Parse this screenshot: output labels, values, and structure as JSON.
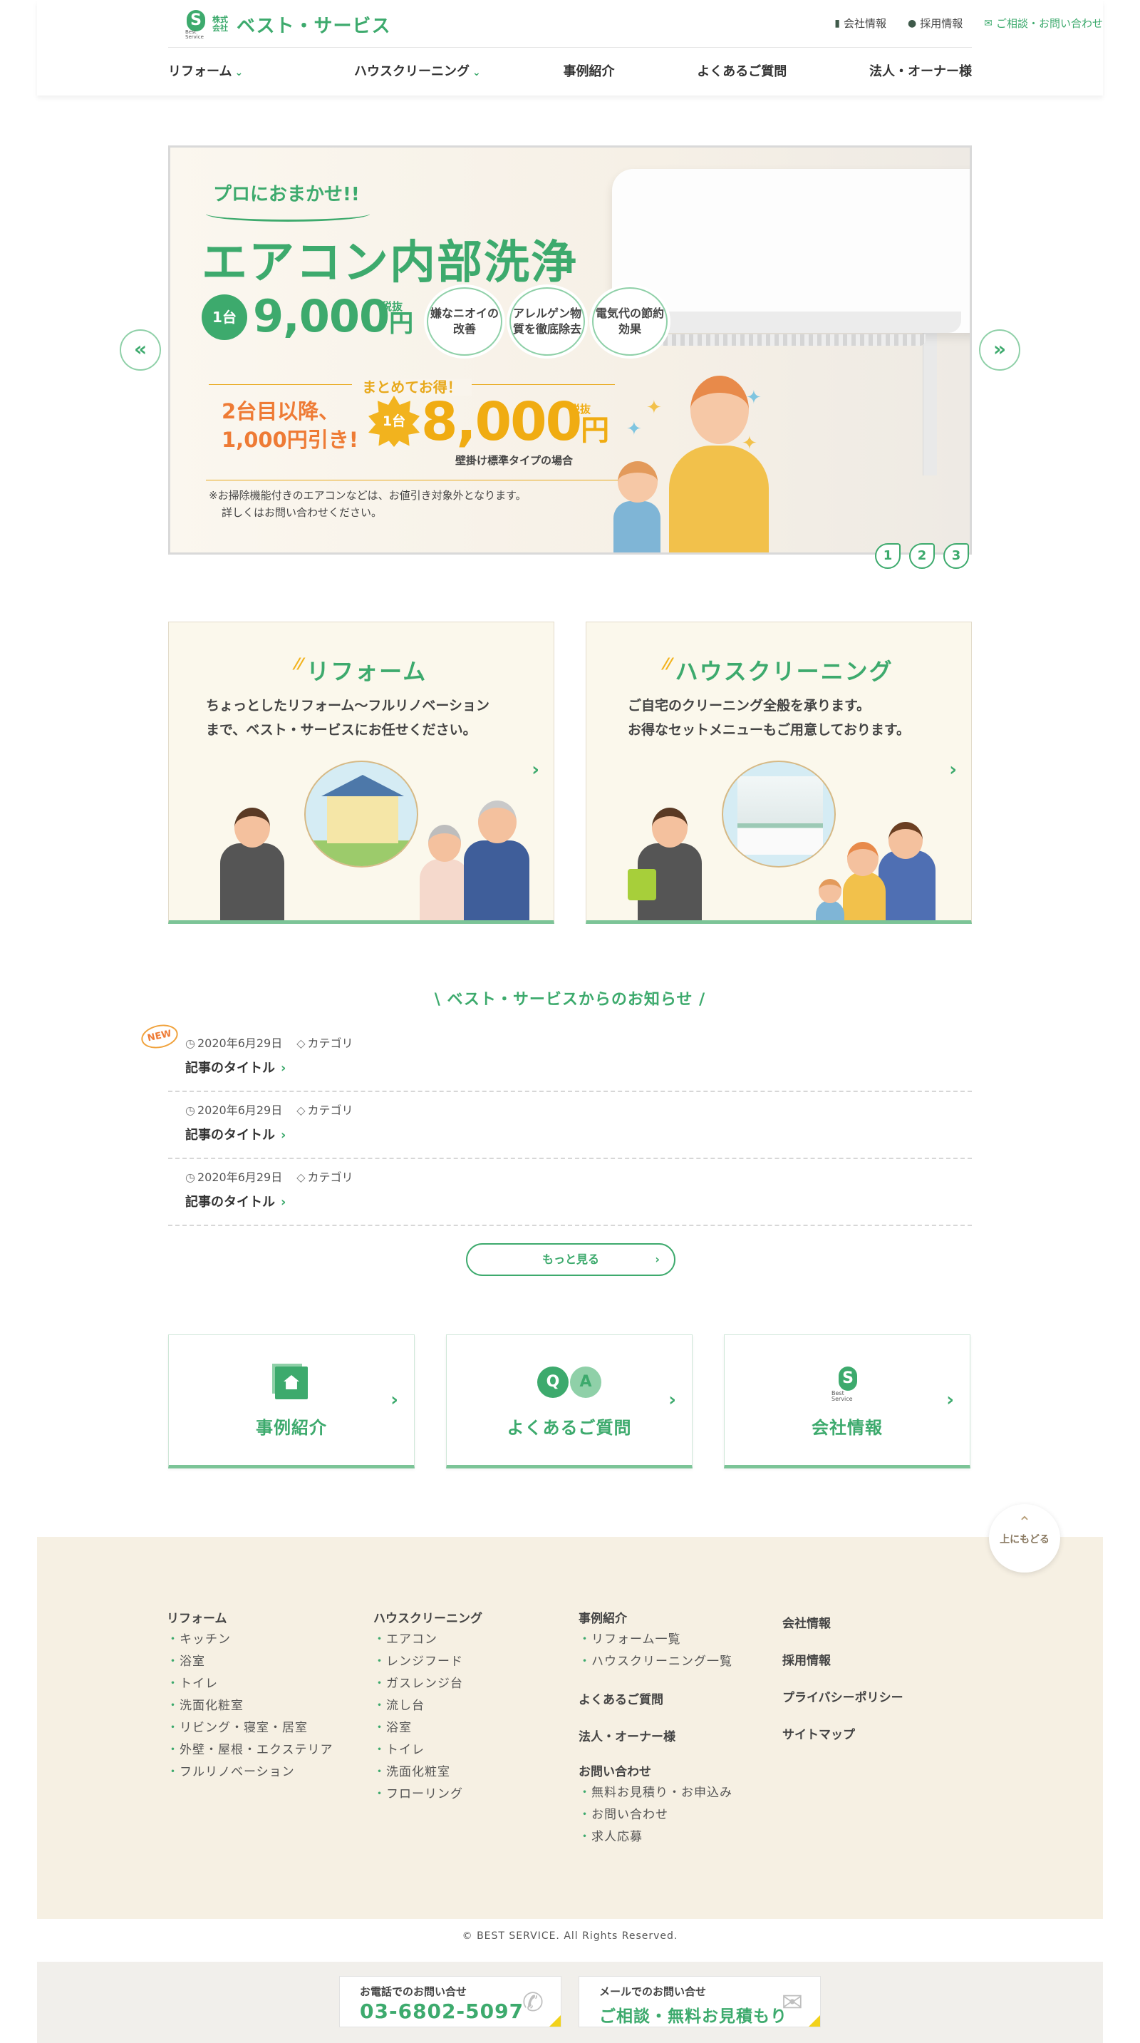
{
  "header": {
    "logo_corp": "株式会社",
    "logo_name": "ベスト・サービス",
    "logo_sub": "Best Service",
    "top_links": [
      "会社情報",
      "採用情報",
      "ご相談・お問い合わせ"
    ],
    "nav": [
      "リフォーム",
      "ハウスクリーニング",
      "事例紹介",
      "よくあるご質問",
      "法人・オーナー様"
    ]
  },
  "slider": {
    "catch": "プロにおまかせ!!",
    "headline": "エアコン内部洗浄",
    "unit1": "1台",
    "price1": "9,000",
    "yen": "円",
    "tax": "税抜",
    "features": [
      "嫌なニオイの改善",
      "アレルゲン物質を徹底除去",
      "電気代の節約効果"
    ],
    "matome": "まとめてお得！",
    "discount": [
      "2台目以降、",
      "1,000円引き!"
    ],
    "unit2": "1台",
    "price2": "8,000",
    "price_note": "壁掛け標準タイプの場合",
    "note": [
      "※お掃除機能付きのエアコンなどは、お値引き対象外となります。",
      "詳しくはお問い合わせください。"
    ],
    "dots": [
      "1",
      "2",
      "3"
    ],
    "active_dot": 1
  },
  "services": [
    {
      "title": "リフォーム",
      "desc": [
        "ちょっとしたリフォーム〜フルリノベーション",
        "まで、ベスト・サービスにお任せください。"
      ]
    },
    {
      "title": "ハウスクリーニング",
      "desc": [
        "ご自宅のクリーニング全般を承ります。",
        "お得なセットメニューもご用意しております。"
      ]
    }
  ],
  "news": {
    "title": "ベスト・サービスからのお知らせ",
    "new_label": "NEW",
    "items": [
      {
        "date": "2020年6月29日",
        "category": "カテゴリ",
        "title": "記事のタイトル"
      },
      {
        "date": "2020年6月29日",
        "category": "カテゴリ",
        "title": "記事のタイトル"
      },
      {
        "date": "2020年6月29日",
        "category": "カテゴリ",
        "title": "記事のタイトル"
      }
    ],
    "more": "もっと見る"
  },
  "link_boxes": [
    {
      "label": "事例紹介",
      "icon": "case-icon"
    },
    {
      "label": "よくあるご質問",
      "icon": "qa-icon"
    },
    {
      "label": "会社情報",
      "icon": "company-logo-icon"
    }
  ],
  "to_top": "上にもどる",
  "footer": {
    "reform": {
      "heading": "リフォーム",
      "items": [
        "キッチン",
        "浴室",
        "トイレ",
        "洗面化粧室",
        "リビング・寝室・居室",
        "外壁・屋根・エクステリア",
        "フルリノベーション"
      ]
    },
    "cleaning": {
      "heading": "ハウスクリーニング",
      "items": [
        "エアコン",
        "レンジフード",
        "ガスレンジ台",
        "流し台",
        "浴室",
        "トイレ",
        "洗面化粧室",
        "フローリング"
      ]
    },
    "cases": {
      "heading": "事例紹介",
      "items": [
        "リフォーム一覧",
        "ハウスクリーニング一覧"
      ]
    },
    "faq": "よくあるご質問",
    "corporate": "法人・オーナー様",
    "inquiry": {
      "heading": "お問い合わせ",
      "items": [
        "無料お見積り・お申込み",
        "お問い合わせ",
        "求人応募"
      ]
    },
    "col4": [
      "会社情報",
      "採用情報",
      "プライバシーポリシー",
      "サイトマップ"
    ],
    "copyright": "© BEST SERVICE. All Rights Reserved."
  },
  "contact": {
    "phone_label": "お電話でのお問い合せ",
    "phone": "03-6802-5097",
    "mail_label": "メールでのお問い合せ",
    "mail_text": "ご相談・無料お見積もり"
  },
  "colors": {
    "brand": "#3daa6d",
    "accent": "#f0ac12",
    "orange": "#ee7b35",
    "footer_bg": "#f6f0e3"
  }
}
